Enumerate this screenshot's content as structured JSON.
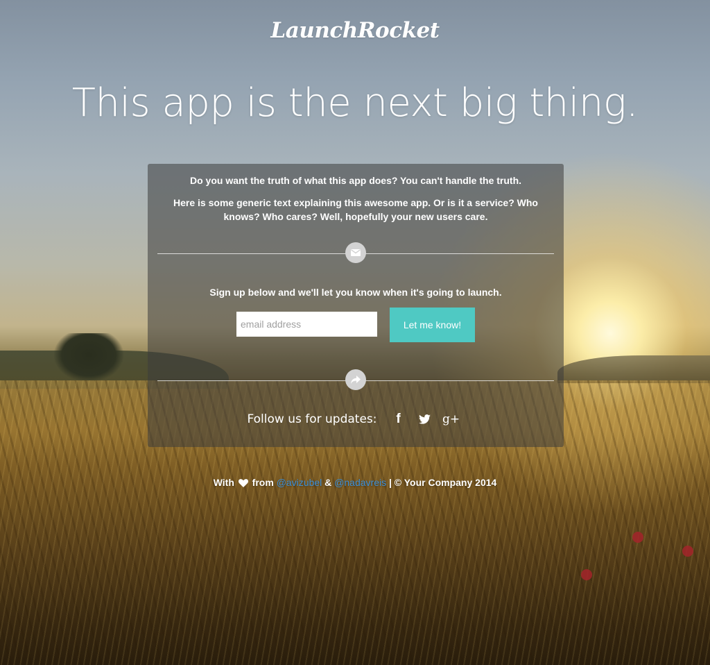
{
  "header": {
    "logo_text": "LaunchRocket",
    "headline": "This app is the next big thing."
  },
  "panel": {
    "intro_line_1": "Do you want the truth of what this app does? You can't handle the truth.",
    "intro_line_2": "Here is some generic text explaining this awesome app. Or is it a service? Who knows? Who cares? Well, hopefully your new users care.",
    "signup_text": "Sign up below and we'll let you know when it's going to launch.",
    "email_placeholder": "email address",
    "email_value": "",
    "submit_label": "Let me know!",
    "follow_label": "Follow us for updates:",
    "social": [
      {
        "name": "facebook",
        "glyph": "f",
        "icon": "facebook-icon"
      },
      {
        "name": "twitter",
        "glyph": "",
        "icon": "twitter-icon"
      },
      {
        "name": "google-plus",
        "glyph": "g+",
        "icon": "google-plus-icon"
      }
    ],
    "divider_icons": [
      "envelope-icon",
      "share-arrow-icon"
    ]
  },
  "footer": {
    "with": "With",
    "from": "from",
    "author1": "@avizubel",
    "amp": "&",
    "author2": "@nadavreis",
    "copyright": "| © Your Company 2014"
  },
  "colors": {
    "accent": "#4fc9c3",
    "link": "#3d8fd6",
    "panel": "rgba(60,60,60,0.55)"
  }
}
